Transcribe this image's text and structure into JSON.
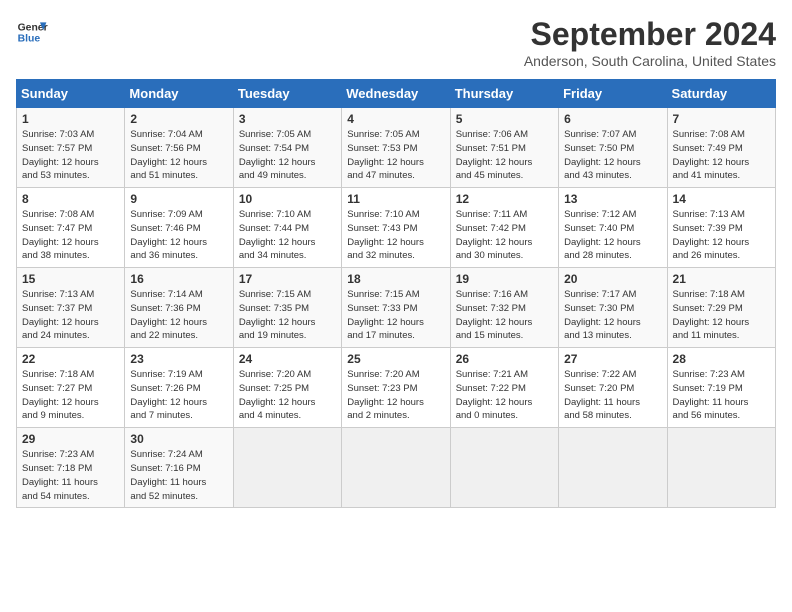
{
  "header": {
    "logo_line1": "General",
    "logo_line2": "Blue",
    "month_title": "September 2024",
    "location": "Anderson, South Carolina, United States"
  },
  "weekdays": [
    "Sunday",
    "Monday",
    "Tuesday",
    "Wednesday",
    "Thursday",
    "Friday",
    "Saturday"
  ],
  "weeks": [
    [
      {
        "day": "1",
        "info": "Sunrise: 7:03 AM\nSunset: 7:57 PM\nDaylight: 12 hours\nand 53 minutes."
      },
      {
        "day": "2",
        "info": "Sunrise: 7:04 AM\nSunset: 7:56 PM\nDaylight: 12 hours\nand 51 minutes."
      },
      {
        "day": "3",
        "info": "Sunrise: 7:05 AM\nSunset: 7:54 PM\nDaylight: 12 hours\nand 49 minutes."
      },
      {
        "day": "4",
        "info": "Sunrise: 7:05 AM\nSunset: 7:53 PM\nDaylight: 12 hours\nand 47 minutes."
      },
      {
        "day": "5",
        "info": "Sunrise: 7:06 AM\nSunset: 7:51 PM\nDaylight: 12 hours\nand 45 minutes."
      },
      {
        "day": "6",
        "info": "Sunrise: 7:07 AM\nSunset: 7:50 PM\nDaylight: 12 hours\nand 43 minutes."
      },
      {
        "day": "7",
        "info": "Sunrise: 7:08 AM\nSunset: 7:49 PM\nDaylight: 12 hours\nand 41 minutes."
      }
    ],
    [
      {
        "day": "8",
        "info": "Sunrise: 7:08 AM\nSunset: 7:47 PM\nDaylight: 12 hours\nand 38 minutes."
      },
      {
        "day": "9",
        "info": "Sunrise: 7:09 AM\nSunset: 7:46 PM\nDaylight: 12 hours\nand 36 minutes."
      },
      {
        "day": "10",
        "info": "Sunrise: 7:10 AM\nSunset: 7:44 PM\nDaylight: 12 hours\nand 34 minutes."
      },
      {
        "day": "11",
        "info": "Sunrise: 7:10 AM\nSunset: 7:43 PM\nDaylight: 12 hours\nand 32 minutes."
      },
      {
        "day": "12",
        "info": "Sunrise: 7:11 AM\nSunset: 7:42 PM\nDaylight: 12 hours\nand 30 minutes."
      },
      {
        "day": "13",
        "info": "Sunrise: 7:12 AM\nSunset: 7:40 PM\nDaylight: 12 hours\nand 28 minutes."
      },
      {
        "day": "14",
        "info": "Sunrise: 7:13 AM\nSunset: 7:39 PM\nDaylight: 12 hours\nand 26 minutes."
      }
    ],
    [
      {
        "day": "15",
        "info": "Sunrise: 7:13 AM\nSunset: 7:37 PM\nDaylight: 12 hours\nand 24 minutes."
      },
      {
        "day": "16",
        "info": "Sunrise: 7:14 AM\nSunset: 7:36 PM\nDaylight: 12 hours\nand 22 minutes."
      },
      {
        "day": "17",
        "info": "Sunrise: 7:15 AM\nSunset: 7:35 PM\nDaylight: 12 hours\nand 19 minutes."
      },
      {
        "day": "18",
        "info": "Sunrise: 7:15 AM\nSunset: 7:33 PM\nDaylight: 12 hours\nand 17 minutes."
      },
      {
        "day": "19",
        "info": "Sunrise: 7:16 AM\nSunset: 7:32 PM\nDaylight: 12 hours\nand 15 minutes."
      },
      {
        "day": "20",
        "info": "Sunrise: 7:17 AM\nSunset: 7:30 PM\nDaylight: 12 hours\nand 13 minutes."
      },
      {
        "day": "21",
        "info": "Sunrise: 7:18 AM\nSunset: 7:29 PM\nDaylight: 12 hours\nand 11 minutes."
      }
    ],
    [
      {
        "day": "22",
        "info": "Sunrise: 7:18 AM\nSunset: 7:27 PM\nDaylight: 12 hours\nand 9 minutes."
      },
      {
        "day": "23",
        "info": "Sunrise: 7:19 AM\nSunset: 7:26 PM\nDaylight: 12 hours\nand 7 minutes."
      },
      {
        "day": "24",
        "info": "Sunrise: 7:20 AM\nSunset: 7:25 PM\nDaylight: 12 hours\nand 4 minutes."
      },
      {
        "day": "25",
        "info": "Sunrise: 7:20 AM\nSunset: 7:23 PM\nDaylight: 12 hours\nand 2 minutes."
      },
      {
        "day": "26",
        "info": "Sunrise: 7:21 AM\nSunset: 7:22 PM\nDaylight: 12 hours\nand 0 minutes."
      },
      {
        "day": "27",
        "info": "Sunrise: 7:22 AM\nSunset: 7:20 PM\nDaylight: 11 hours\nand 58 minutes."
      },
      {
        "day": "28",
        "info": "Sunrise: 7:23 AM\nSunset: 7:19 PM\nDaylight: 11 hours\nand 56 minutes."
      }
    ],
    [
      {
        "day": "29",
        "info": "Sunrise: 7:23 AM\nSunset: 7:18 PM\nDaylight: 11 hours\nand 54 minutes."
      },
      {
        "day": "30",
        "info": "Sunrise: 7:24 AM\nSunset: 7:16 PM\nDaylight: 11 hours\nand 52 minutes."
      },
      {
        "day": "",
        "info": ""
      },
      {
        "day": "",
        "info": ""
      },
      {
        "day": "",
        "info": ""
      },
      {
        "day": "",
        "info": ""
      },
      {
        "day": "",
        "info": ""
      }
    ]
  ]
}
